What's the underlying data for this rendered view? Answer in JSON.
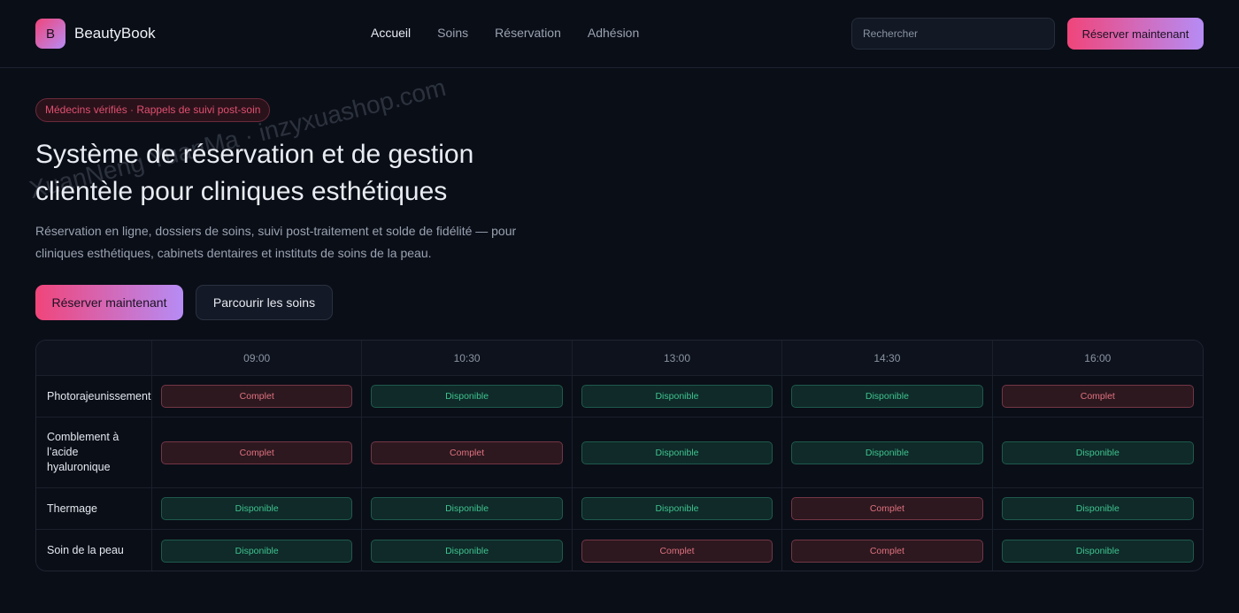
{
  "brand": {
    "logo_letter": "B",
    "name": "BeautyBook"
  },
  "nav": [
    {
      "label": "Accueil",
      "active": true
    },
    {
      "label": "Soins",
      "active": false
    },
    {
      "label": "Réservation",
      "active": false
    },
    {
      "label": "Adhésion",
      "active": false
    }
  ],
  "search": {
    "placeholder": "Rechercher"
  },
  "header_cta": "Réserver maintenant",
  "watermark": "XuanNeng YuanMa · inzyxuashop.com",
  "hero": {
    "pill": "Médecins vérifiés · Rappels de suivi post-soin",
    "title_line1": "Système de réservation et de gestion",
    "title_line2": "clientèle pour cliniques esthétiques",
    "desc_line1": "Réservation en ligne, dossiers de soins, suivi post-traitement et solde de fidélité — pour",
    "desc_line2": "cliniques esthétiques, cabinets dentaires et instituts de soins de la peau.",
    "primary_cta": "Réserver maintenant",
    "secondary_cta": "Parcourir les soins"
  },
  "schedule": {
    "times": [
      "09:00",
      "10:30",
      "13:00",
      "14:30",
      "16:00"
    ],
    "labels": {
      "available": "Disponible",
      "full": "Complet"
    },
    "rows": [
      {
        "treatment": "Photorajeunissement",
        "slots": [
          "full",
          "available",
          "available",
          "available",
          "full"
        ]
      },
      {
        "treatment": "Comblement à l’acide hyaluronique",
        "slots": [
          "full",
          "full",
          "available",
          "available",
          "available"
        ]
      },
      {
        "treatment": "Thermage",
        "slots": [
          "available",
          "available",
          "available",
          "full",
          "available"
        ]
      },
      {
        "treatment": "Soin de la peau",
        "slots": [
          "available",
          "available",
          "full",
          "full",
          "available"
        ]
      }
    ]
  },
  "colors": {
    "accent_start": "#f0457a",
    "accent_end": "#b68cf5",
    "available": "#3fc48e",
    "full": "#e0727f",
    "background": "#0a0e17"
  }
}
